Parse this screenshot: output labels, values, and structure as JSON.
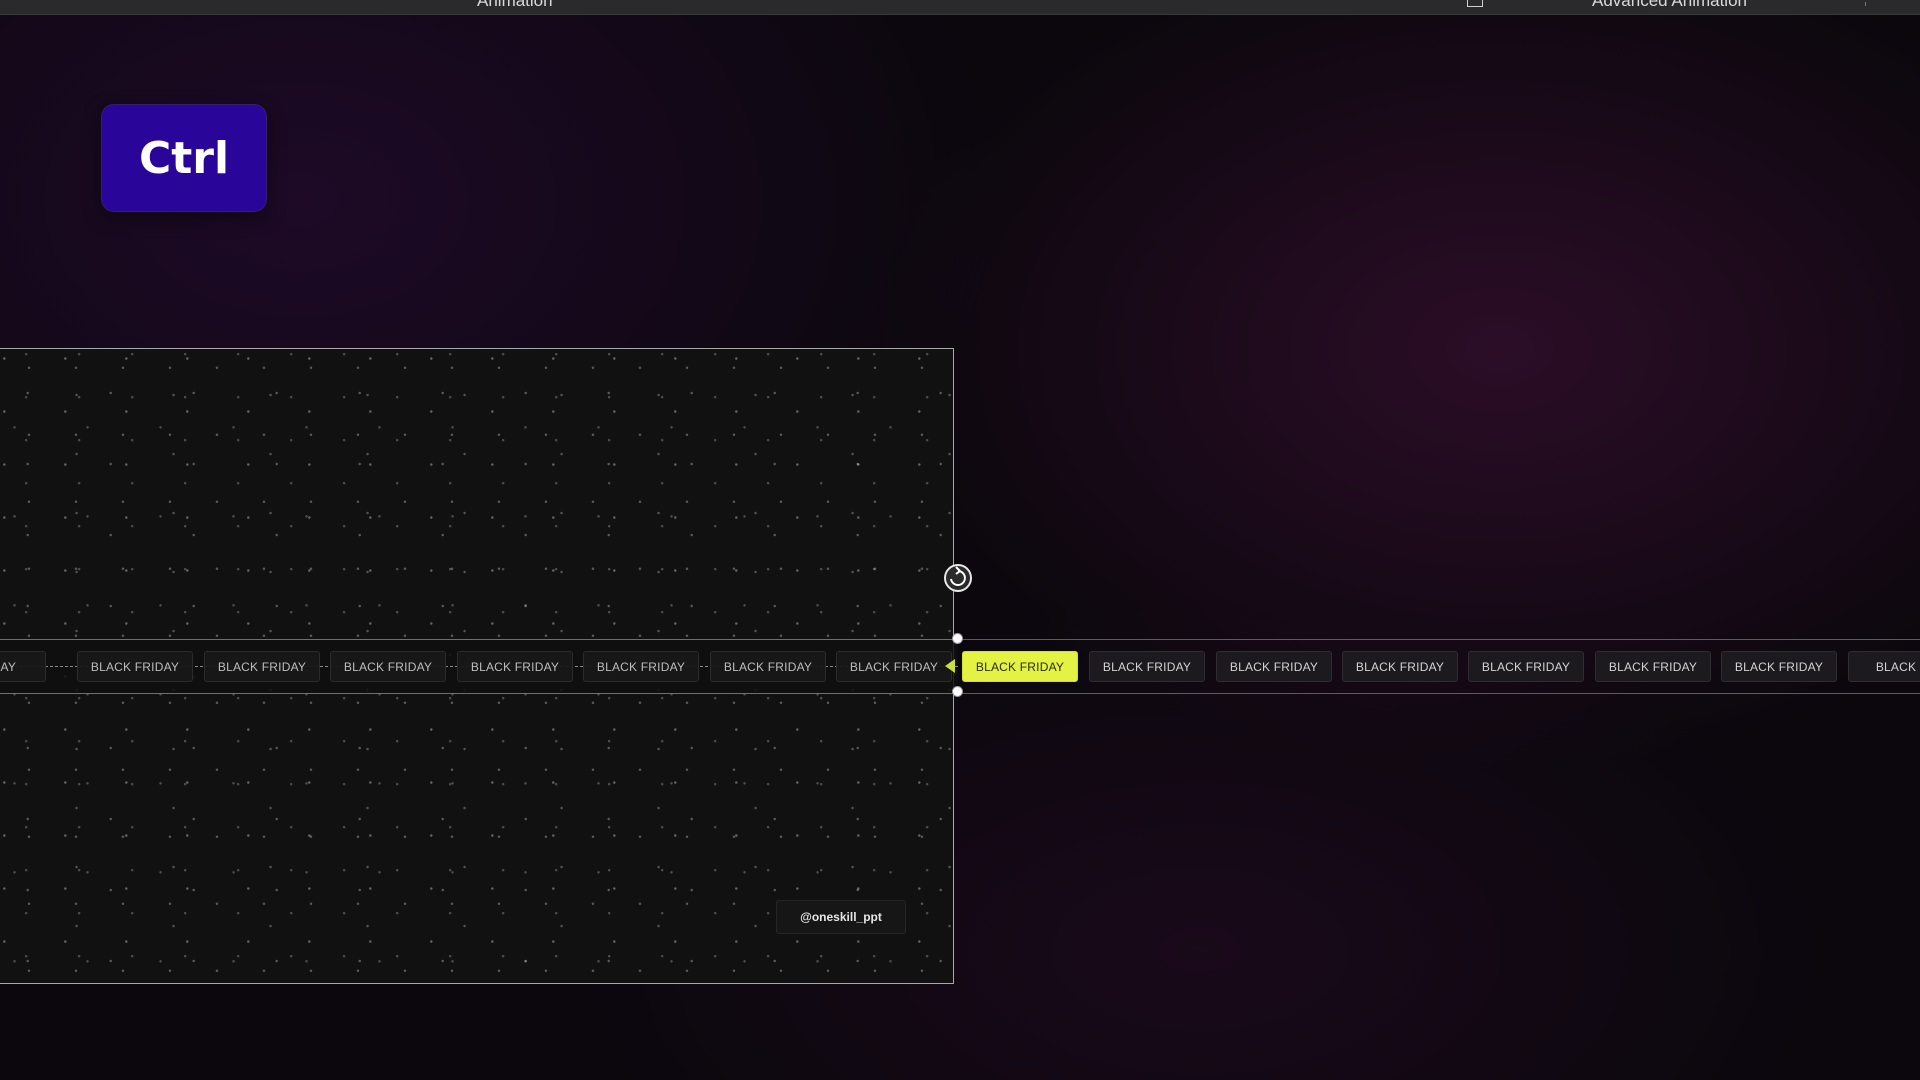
{
  "ribbon": {
    "animation_label": "Animation",
    "advanced_animation_label": "Advanced Animation"
  },
  "key_overlay": {
    "label": "Ctrl",
    "color": "#2a059a"
  },
  "slide": {
    "watermark": "@oneskill_ppt"
  },
  "ticker": {
    "left_items": [
      "K FRIDAY",
      "BLACK FRIDAY",
      "BLACK FRIDAY",
      "BLACK FRIDAY",
      "BLACK FRIDAY",
      "BLACK FRIDAY",
      "BLACK FRIDAY",
      "BLACK FRIDAY"
    ],
    "active_item": "BLACK FRIDAY",
    "active_color": "#e3f243",
    "right_items": [
      "BLACK FRIDAY",
      "BLACK FRIDAY",
      "BLACK FRIDAY",
      "BLACK FRIDAY",
      "BLACK FRIDAY",
      "BLACK FRIDAY",
      "BLACK FR"
    ]
  },
  "icons": {
    "rotate": "rotate-icon",
    "handle": "resize-handle-icon",
    "motion_path_end": "motion-path-arrow-icon"
  }
}
